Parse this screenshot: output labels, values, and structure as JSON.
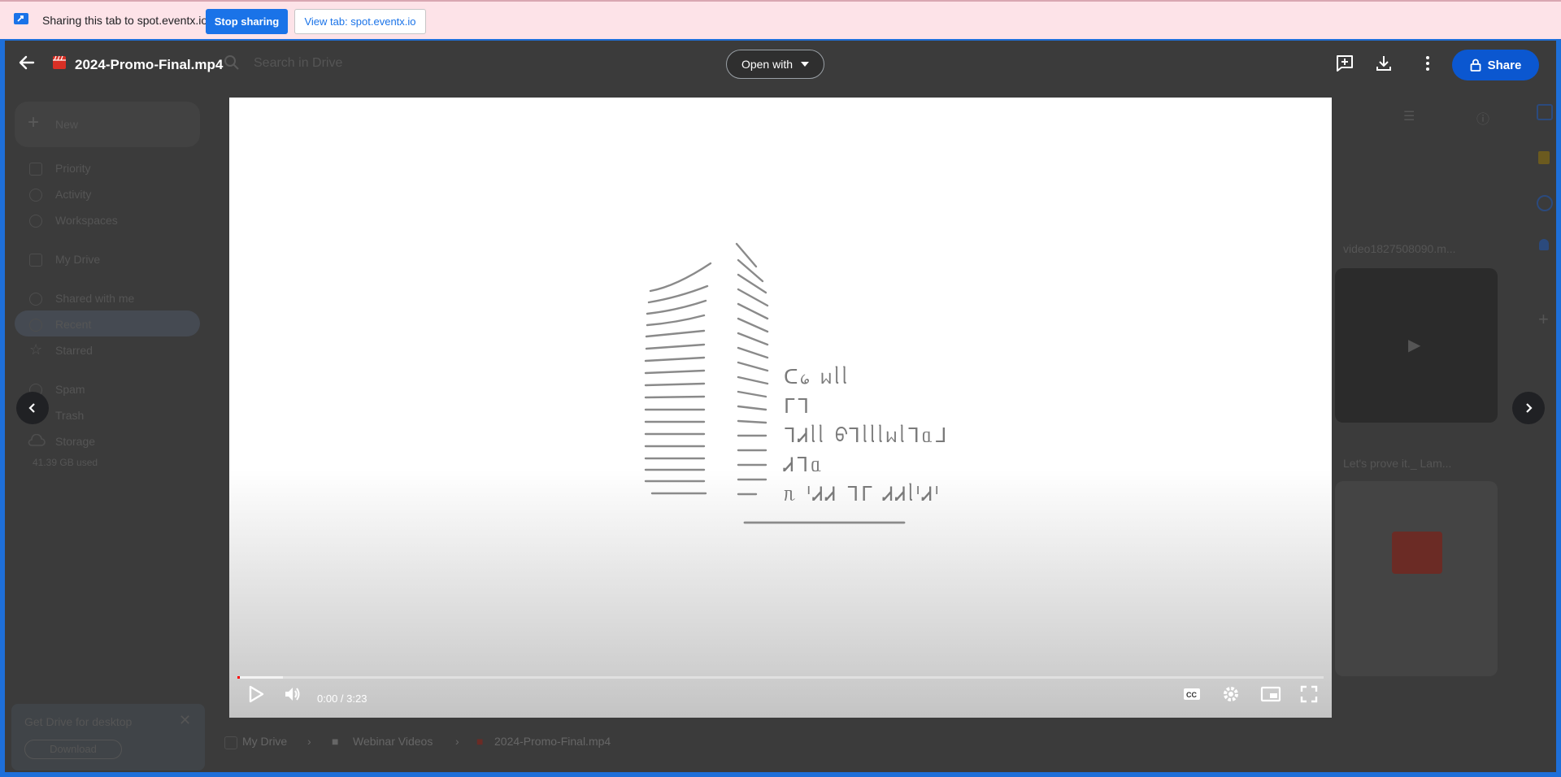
{
  "share_banner": {
    "text": "Sharing this tab to spot.eventx.io",
    "stop_label": "Stop sharing",
    "view_label": "View tab: spot.eventx.io"
  },
  "viewer": {
    "file_title": "2024-Promo-Final.mp4",
    "open_with_label": "Open with",
    "share_label": "Share"
  },
  "player": {
    "time": "0:00 / 3:23",
    "progress_played": 0.0,
    "video_text": [
      "ᑕ᥀ ᥕᥣᥣ",
      "ᒥᒣ",
      "ᒣᏗᥣᥣ ᠪᒣᥣᥣᥣᥕᥣᒣᥲᒧ",
      "Ꮧᒣᥲ",
      "ᥰ ᑊᏗᏗ ᒣᒥ ᏗᏗᥣᑊᏗᑊ"
    ]
  },
  "drive_bg": {
    "search_placeholder": "Search in Drive",
    "new_label": "New",
    "nav": [
      "Priority",
      "Activity",
      "Workspaces",
      "My Drive",
      "Shared with me",
      "Recent",
      "Starred",
      "Spam",
      "Trash",
      "Storage"
    ],
    "storage_used": "41.39 GB used",
    "card1_title": "video1827508090.m...",
    "card2_title": "Let's prove it._ Lam...",
    "get_drive_title": "Get Drive for desktop",
    "download_label": "Download",
    "breadcrumb": [
      "My Drive",
      "Webinar Videos",
      "2024-Promo-Final.mp4"
    ]
  },
  "colors": {
    "banner_bg": "#fde3e8",
    "accent": "#1a73e8",
    "share_btn": "#0b57d0",
    "frame_border": "#1e6fd9",
    "viewer_bg": "#3b3b3b"
  },
  "icons": {
    "cast": "cast-icon",
    "back": "arrow-left-icon",
    "file": "video-file-icon",
    "add_comment": "add-comment-icon",
    "download": "download-icon",
    "more": "more-vert-icon",
    "lock": "lock-icon"
  }
}
